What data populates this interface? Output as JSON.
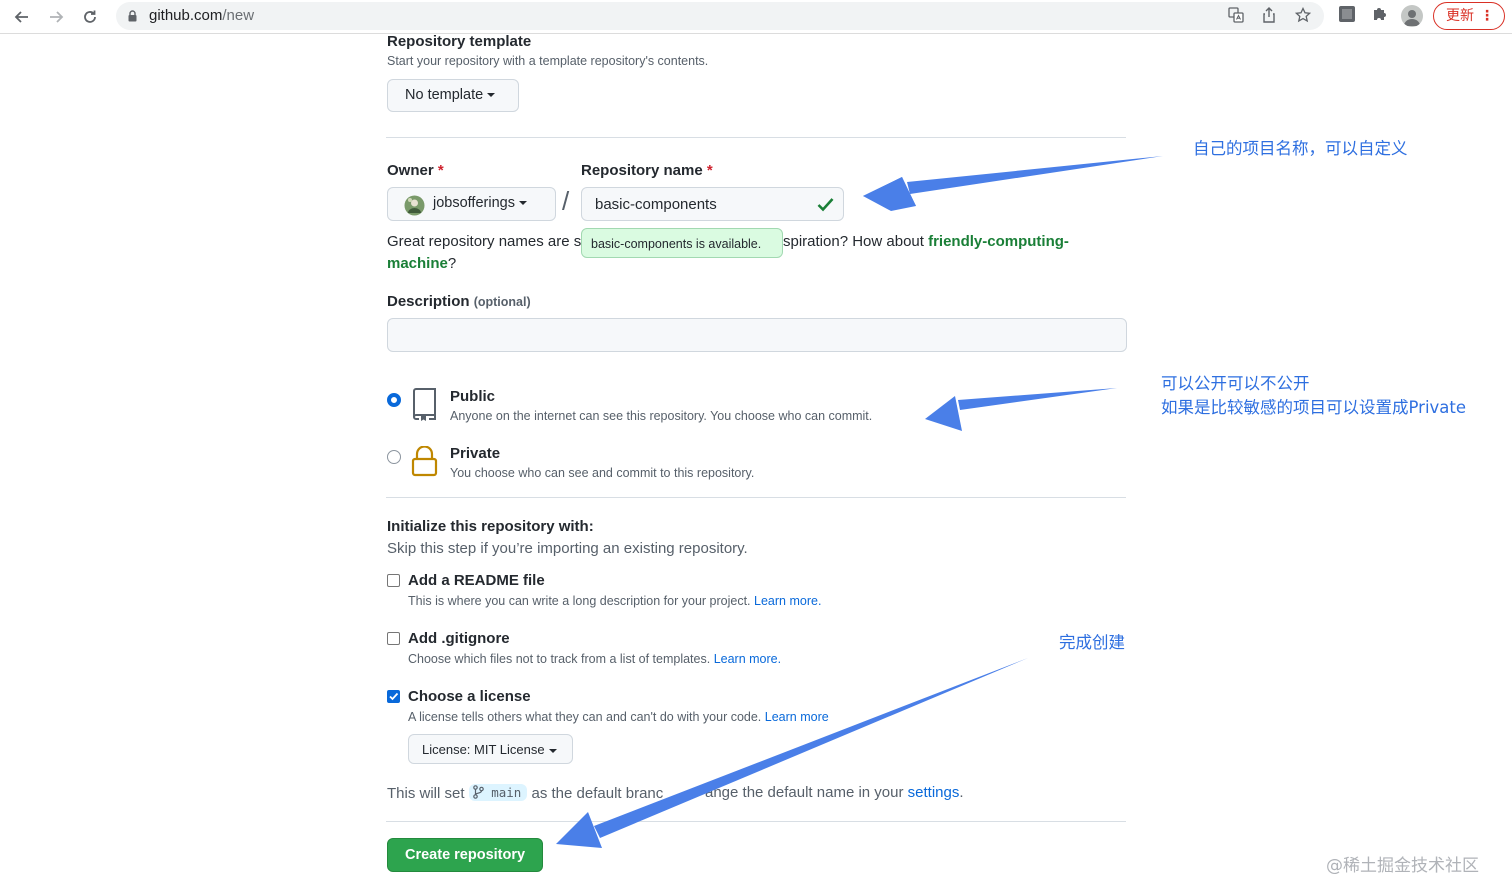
{
  "browser": {
    "url_host": "github.com",
    "url_path": "/new",
    "update_label": "更新",
    "update_menu": "⋮"
  },
  "template": {
    "heading": "Repository template",
    "description": "Start your repository with a template repository's contents.",
    "button_label": "No template"
  },
  "owner": {
    "label": "Owner",
    "required_mark": "*",
    "value": "jobsofferings",
    "separator": "/"
  },
  "repo_name": {
    "label": "Repository name",
    "required_mark": "*",
    "value": "basic-components",
    "availability_tooltip": "basic-components is available."
  },
  "suggestion": {
    "prefix_visible": "Great repository names are s",
    "suffix_visible": "spiration? How about ",
    "suggested_name_part1": "friendly-computing-",
    "suggested_name_part2": "machine",
    "end": "?"
  },
  "description": {
    "label": "Description",
    "optional": "(optional)",
    "value": ""
  },
  "visibility": {
    "options": [
      {
        "title": "Public",
        "description": "Anyone on the internet can see this repository. You choose who can commit.",
        "selected": true
      },
      {
        "title": "Private",
        "description": "You choose who can see and commit to this repository.",
        "selected": false
      }
    ]
  },
  "initialize": {
    "heading": "Initialize this repository with:",
    "subheading": "Skip this step if you’re importing an existing repository.",
    "options": [
      {
        "title": "Add a README file",
        "description": "This is where you can write a long description for your project.",
        "link": "Learn more.",
        "checked": false
      },
      {
        "title": "Add .gitignore",
        "description": "Choose which files not to track from a list of templates.",
        "link": "Learn more.",
        "checked": false
      },
      {
        "title": "Choose a license",
        "description": "A license tells others what they can and can't do with your code.",
        "link": "Learn more",
        "checked": true
      }
    ],
    "license_button": "License: MIT License"
  },
  "default_branch": {
    "prefix": "This will set",
    "branch": "main",
    "middle": "as the default branc",
    "middle2": "ange the default name in your",
    "link": "settings",
    "end": "."
  },
  "submit": {
    "label": "Create repository"
  },
  "annotations": {
    "name_note": "自己的项目名称，可以自定义",
    "visibility_note_line1": "可以公开可以不公开",
    "visibility_note_line2": "如果是比较敏感的项目可以设置成Private",
    "create_note": "完成创建",
    "arrow_color": "#4a7fe8"
  },
  "watermark": "@稀土掘金技术社区"
}
